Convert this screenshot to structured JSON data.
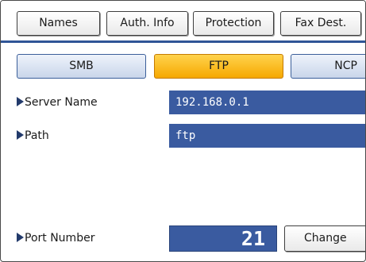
{
  "tabs": [
    {
      "label": "Names"
    },
    {
      "label": "Auth. Info"
    },
    {
      "label": "Protection"
    },
    {
      "label": "Fax Dest."
    }
  ],
  "protocols": [
    {
      "label": "SMB",
      "selected": false
    },
    {
      "label": "FTP",
      "selected": true
    },
    {
      "label": "NCP",
      "selected": false
    }
  ],
  "fields": {
    "server_name": {
      "label": "Server Name",
      "value": "192.168.0.1"
    },
    "path": {
      "label": "Path",
      "value": "ftp"
    },
    "port_number": {
      "label": "Port Number",
      "value": "21"
    }
  },
  "change_label": "Change",
  "colors": {
    "accent_blue": "#3a5ba0",
    "selected_yellow": "#f6a800",
    "divider": "#2f5597"
  }
}
